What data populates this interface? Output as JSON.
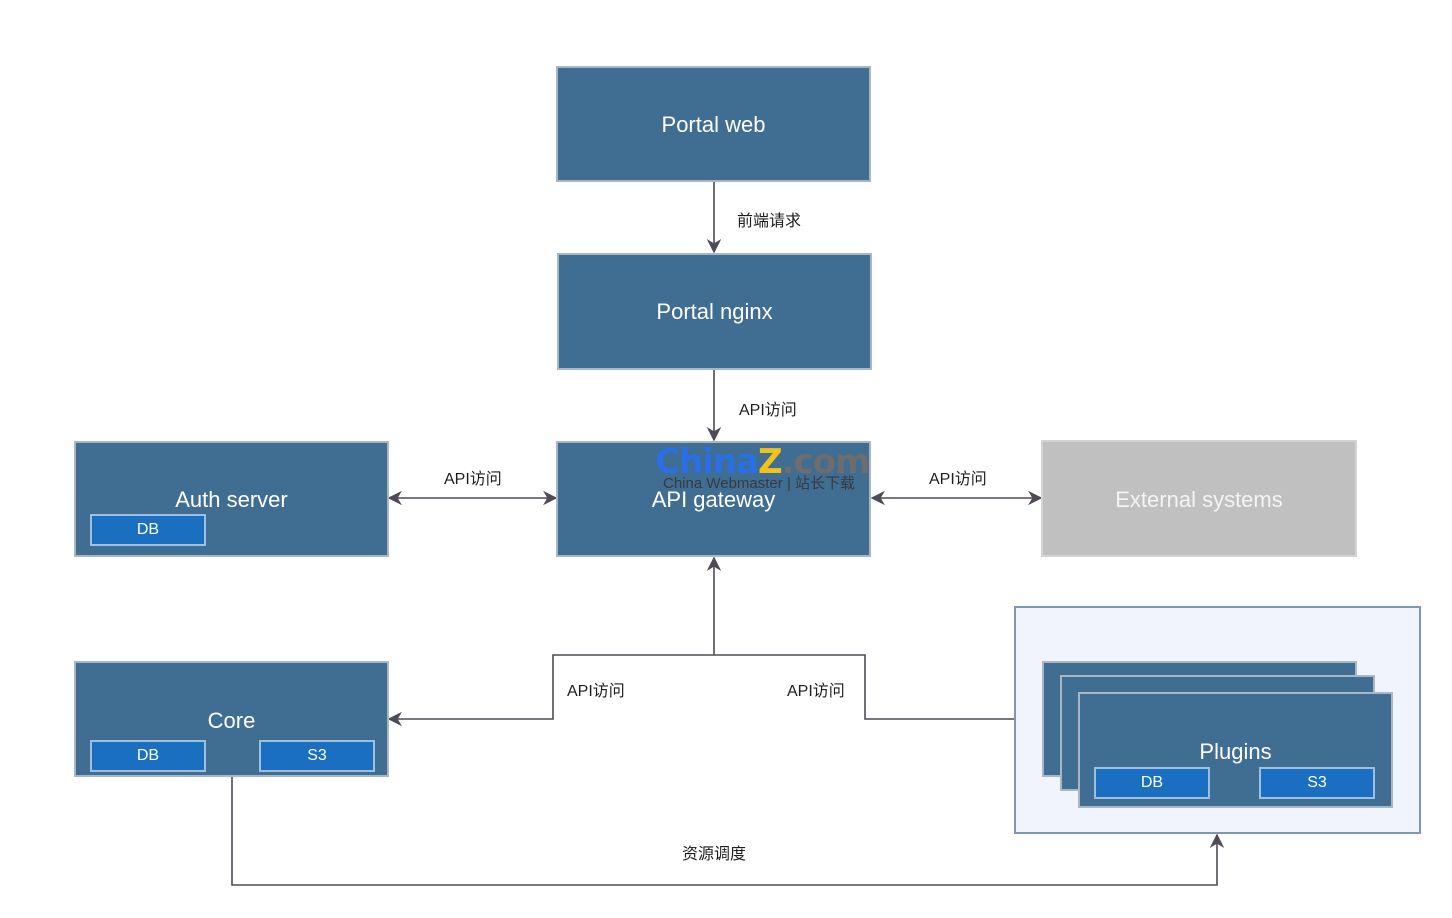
{
  "colors": {
    "node_fill": "#406d92",
    "node_border": "#a9b6c4",
    "external_fill": "#c0c0c0",
    "storage_fill": "#1a6fc0",
    "container_fill": "#f1f4fa",
    "edge_color": "#4f4a55"
  },
  "nodes": {
    "portal_web": {
      "label": "Portal web"
    },
    "portal_nginx": {
      "label": "Portal nginx"
    },
    "api_gateway": {
      "label": "API gateway"
    },
    "auth_server": {
      "label": "Auth server",
      "storage": [
        "DB"
      ]
    },
    "external_systems": {
      "label": "External systems"
    },
    "core": {
      "label": "Core",
      "storage": [
        "DB",
        "S3"
      ]
    },
    "plugins": {
      "label": "Plugins",
      "storage": [
        "DB",
        "S3"
      ]
    }
  },
  "edges": [
    {
      "from": "Portal web",
      "to": "Portal nginx",
      "label": "前端请求"
    },
    {
      "from": "Portal nginx",
      "to": "API gateway",
      "label": "API访问"
    },
    {
      "from": "Auth server",
      "to": "API gateway",
      "label": "API访问",
      "bidirectional": true
    },
    {
      "from": "API gateway",
      "to": "External systems",
      "label": "API访问",
      "bidirectional": true
    },
    {
      "from": "Core",
      "to": "API gateway",
      "label": "API访问"
    },
    {
      "from": "Plugins",
      "to": "API gateway",
      "label": "API访问"
    },
    {
      "from": "Core",
      "to": "Plugins",
      "label": "资源调度"
    }
  ],
  "watermark": {
    "logo_part1": "China",
    "logo_part2": "Z",
    "logo_part3": ".com",
    "subtitle": "China Webmaster | 站长下载"
  }
}
